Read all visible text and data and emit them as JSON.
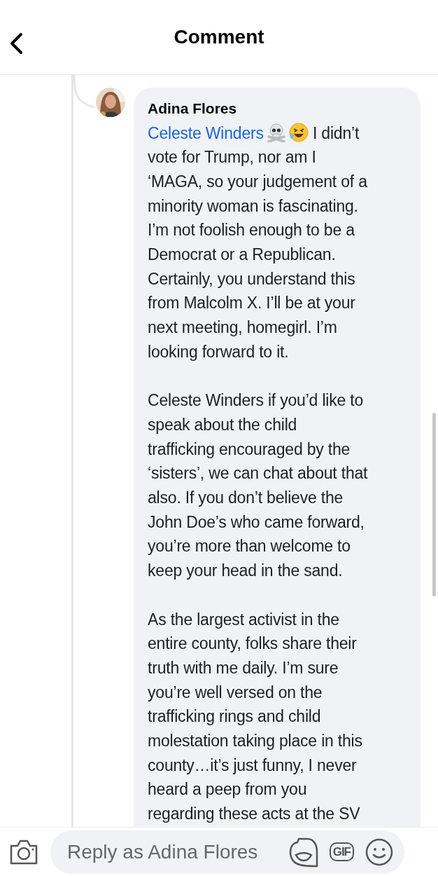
{
  "header": {
    "title": "Comment"
  },
  "comment": {
    "author": "Adina Flores",
    "paragraphs": [
      {
        "mention": "Celeste Winders",
        "lines": [
          "I didn’t",
          "vote for Trump, nor am I",
          "‘MAGA, so your judgement of a",
          "minority woman is fascinating.",
          "I’m not foolish enough to be a",
          "Democrat or a Republican.",
          "Certainly, you understand this",
          "from Malcolm X. I’ll be at your",
          "next meeting, homegirl. I’m",
          "looking forward to it."
        ]
      },
      {
        "lines": [
          "Celeste Winders if you’d like to",
          "speak about the child",
          "trafficking encouraged by the",
          "‘sisters’, we can chat about that",
          "also. If you don’t believe the",
          "John Doe’s who came forward,",
          "you’re more than welcome to",
          "keep your head in the sand."
        ]
      },
      {
        "lines": [
          "As the largest activist in the",
          "entire county, folks share their",
          "truth with me daily. I’m sure",
          "you’re well versed on the",
          "trafficking rings and child",
          "molestation taking place in this",
          "county…it’s just funny, I never",
          "heard a peep from you",
          "regarding these acts at the SV"
        ]
      }
    ]
  },
  "reply_bar": {
    "placeholder": "Reply as Adina Flores",
    "gif_label": "GIF"
  }
}
